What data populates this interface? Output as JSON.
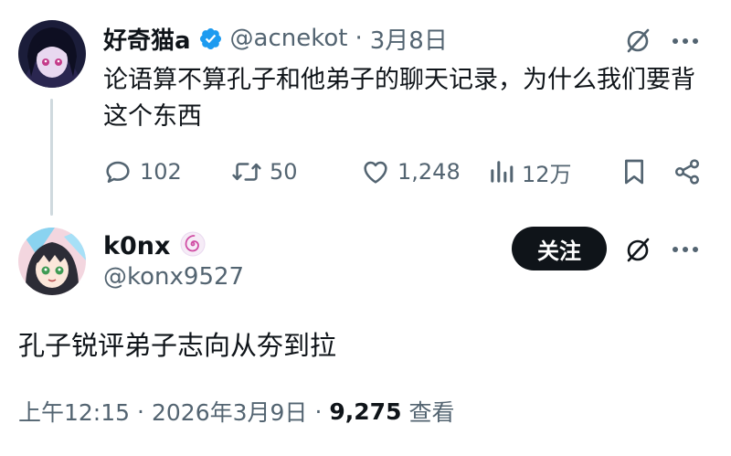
{
  "tweet": {
    "display_name": "好奇猫a",
    "handle": "@acnekot",
    "separator": "·",
    "date": "3月8日",
    "text": "论语算不算孔子和他弟子的聊天记录，为什么我们要背这个东西",
    "stats": {
      "replies": "102",
      "retweets": "50",
      "likes": "1,248",
      "views": "12万"
    }
  },
  "reply": {
    "display_name": "k0nx",
    "handle": "@konx9527",
    "follow_label": "关注",
    "text": "孔子锐评弟子志向从夯到拉",
    "time": "上午12:15",
    "separator1": "·",
    "date": "2026年3月9日",
    "separator2": "·",
    "views": "9,275",
    "views_label": "查看"
  },
  "colors": {
    "text": "#0f1419",
    "muted": "#536471",
    "verified": "#1d9bf0",
    "thread_line": "#cfd9de",
    "follow_bg": "#0f1419"
  },
  "icons": [
    "verified-icon",
    "grok-icon",
    "more-icon",
    "reply-icon",
    "retweet-icon",
    "like-icon",
    "views-icon",
    "bookmark-icon",
    "share-icon",
    "spiral-badge-icon"
  ]
}
